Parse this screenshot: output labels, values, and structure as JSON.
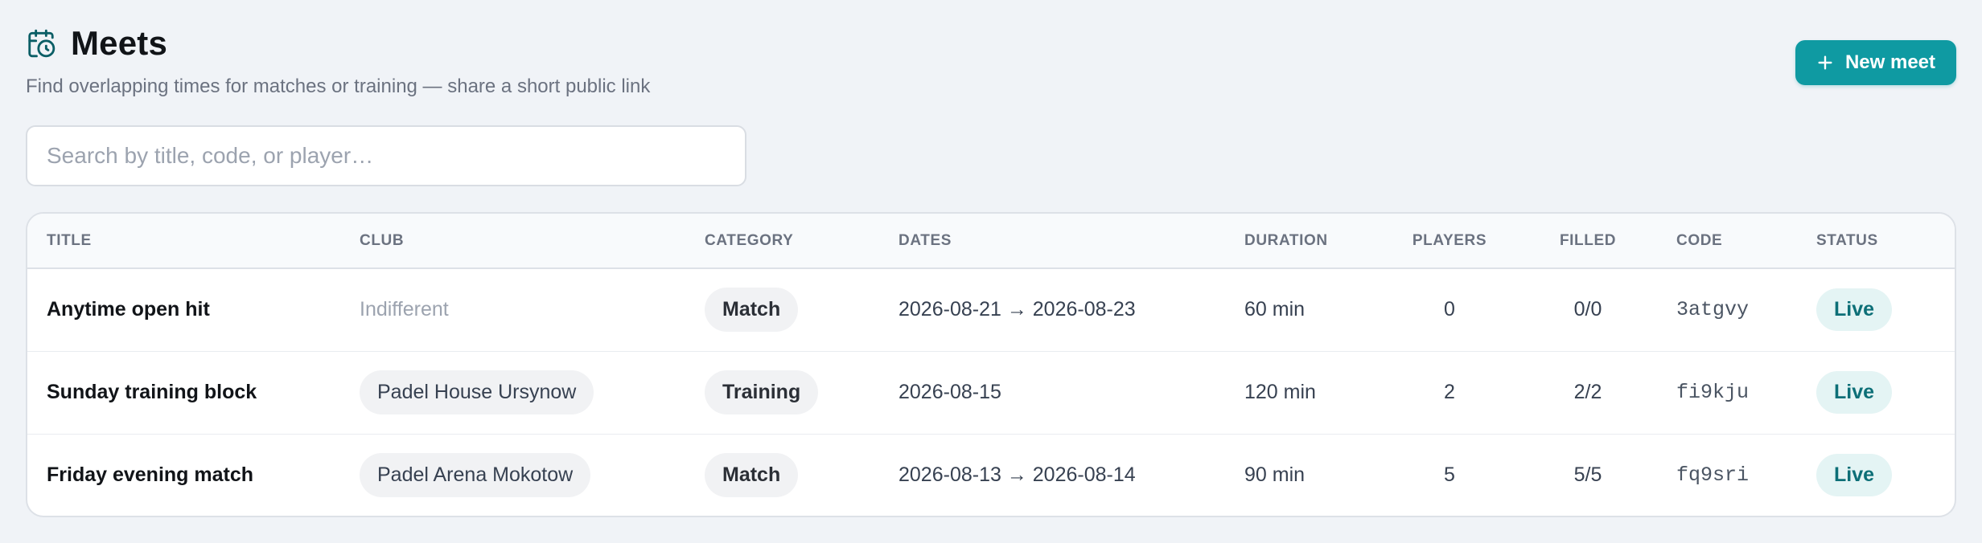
{
  "header": {
    "icon": "calendar-clock-icon",
    "title": "Meets",
    "subtitle": "Find overlapping times for matches or training — share a short public link",
    "new_button_label": "New meet",
    "accent_color": "#0f9aa2"
  },
  "search": {
    "placeholder": "Search by title, code, or player…",
    "value": ""
  },
  "table": {
    "columns": {
      "title": "TITLE",
      "club": "CLUB",
      "category": "CATEGORY",
      "dates": "DATES",
      "duration": "DURATION",
      "players": "PLAYERS",
      "filled": "FILLED",
      "code": "CODE",
      "status": "STATUS"
    },
    "rows": [
      {
        "title": "Anytime open hit",
        "club": "Indifferent",
        "category": "Match",
        "dates": "2026-08-21 → 2026-08-23",
        "duration": "60 min",
        "players": "0",
        "filled": "0/0",
        "code": "3atgvy",
        "status": "Live"
      },
      {
        "title": "Sunday training block",
        "club": "Padel House Ursynow",
        "category": "Training",
        "dates": "2026-08-15",
        "duration": "120 min",
        "players": "2",
        "filled": "2/2",
        "code": "fi9kju",
        "status": "Live"
      },
      {
        "title": "Friday evening match",
        "club": "Padel Arena Mokotow",
        "category": "Match",
        "dates": "2026-08-13 → 2026-08-14",
        "duration": "90 min",
        "players": "5",
        "filled": "5/5",
        "code": "fq9sri",
        "status": "Live"
      }
    ]
  }
}
